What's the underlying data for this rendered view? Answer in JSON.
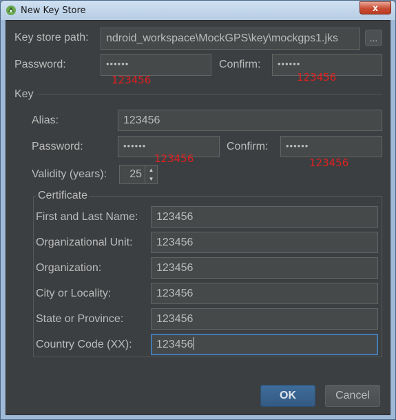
{
  "window": {
    "title": "New Key Store",
    "close_glyph": "x"
  },
  "keystore": {
    "path_label": "Key store path:",
    "path_value": "ndroid_workspace\\MockGPS\\key\\mockgps1.jks",
    "browse_label": "...",
    "password_label": "Password:",
    "password_value": "••••••",
    "password_note": "123456",
    "confirm_label": "Confirm:",
    "confirm_value": "••••••",
    "confirm_note": "123456"
  },
  "key": {
    "section_label": "Key",
    "alias_label": "Alias:",
    "alias_value": "123456",
    "password_label": "Password:",
    "password_value": "••••••",
    "password_note": "123456",
    "confirm_label": "Confirm:",
    "confirm_value": "••••••",
    "confirm_note": "123456",
    "validity_label": "Validity (years):",
    "validity_value": "25"
  },
  "certificate": {
    "legend": "Certificate",
    "fields": [
      {
        "label": "First and Last Name:",
        "value": "123456"
      },
      {
        "label": "Organizational Unit:",
        "value": "123456"
      },
      {
        "label": "Organization:",
        "value": "123456"
      },
      {
        "label": "City or Locality:",
        "value": "123456"
      },
      {
        "label": "State or Province:",
        "value": "123456"
      },
      {
        "label": "Country Code (XX):",
        "value": "123456"
      }
    ]
  },
  "buttons": {
    "ok": "OK",
    "cancel": "Cancel"
  },
  "colors": {
    "panel_bg": "#3c3f41",
    "field_bg": "#45494a",
    "text": "#bbbbbb",
    "accent": "#4a88c7",
    "annotation_red": "#e02020"
  },
  "icons": {
    "app": "android-studio-icon",
    "close": "close-icon",
    "spinner_up": "triangle-up-icon",
    "spinner_down": "triangle-down-icon"
  }
}
